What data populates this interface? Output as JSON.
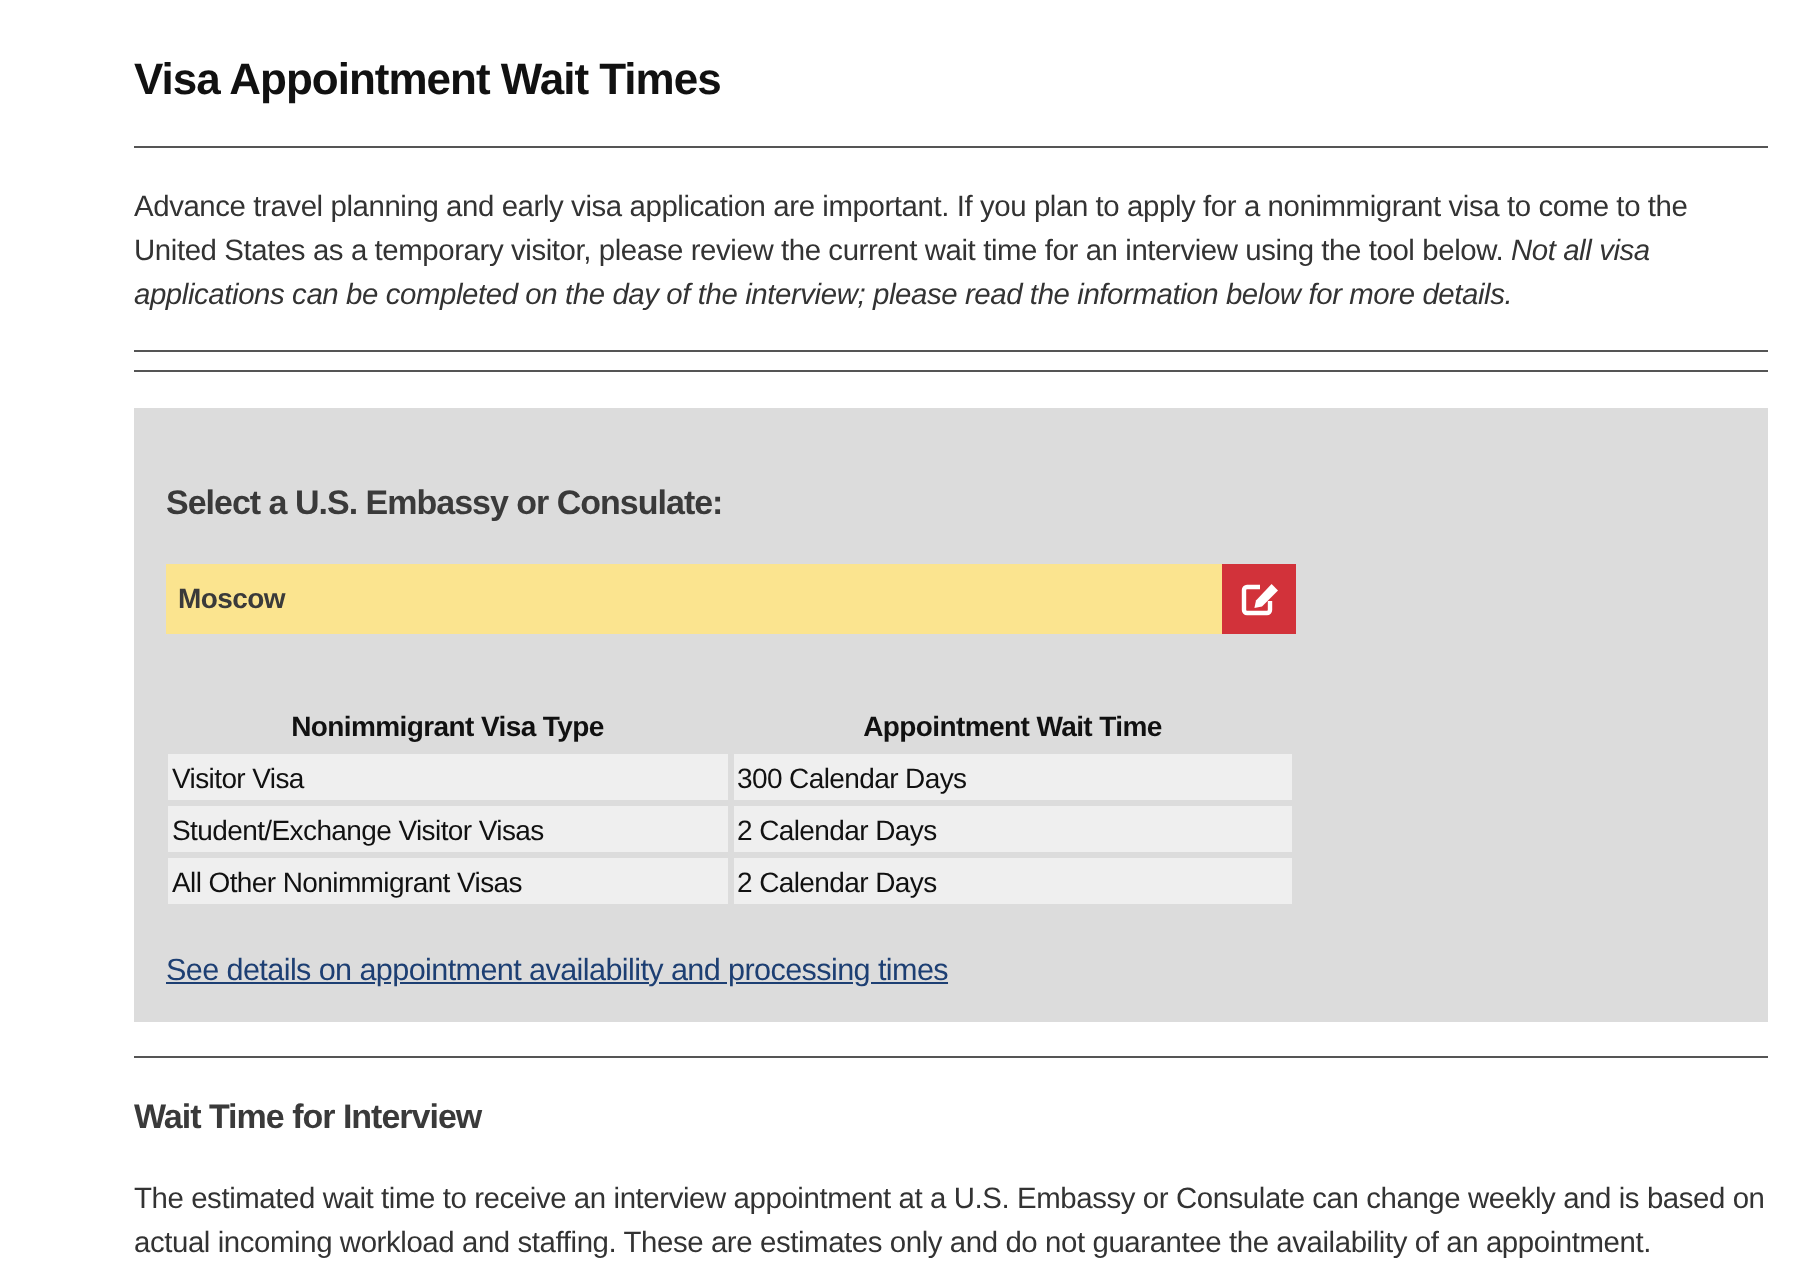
{
  "page": {
    "title": "Visa Appointment Wait Times",
    "intro": "Advance travel planning and early visa application are important. If you plan to apply for a nonimmigrant visa to come to the United States as a temporary visitor, please review the current wait time for an interview using the tool below. *Not all visa applications can be completed on the day of the interview; please read the information below for more details.*"
  },
  "selector": {
    "heading": "Select a U.S. Embassy or Consulate:",
    "value": "Moscow"
  },
  "table": {
    "columns": [
      "Nonimmigrant Visa Type",
      "Appointment Wait Time"
    ],
    "rows": [
      [
        "Visitor Visa",
        "300 Calendar Days"
      ],
      [
        "Student/Exchange Visitor Visas",
        "2 Calendar Days"
      ],
      [
        "All Other Nonimmigrant Visas",
        "2 Calendar Days"
      ]
    ]
  },
  "details_link": "See details on appointment availability and processing times",
  "section": {
    "heading": "Wait Time for Interview",
    "text": "The estimated wait time to receive an interview appointment at a U.S. Embassy or Consulate can change weekly and is based on actual incoming workload and staffing. These are estimates only and do not guarantee the availability of an appointment."
  }
}
